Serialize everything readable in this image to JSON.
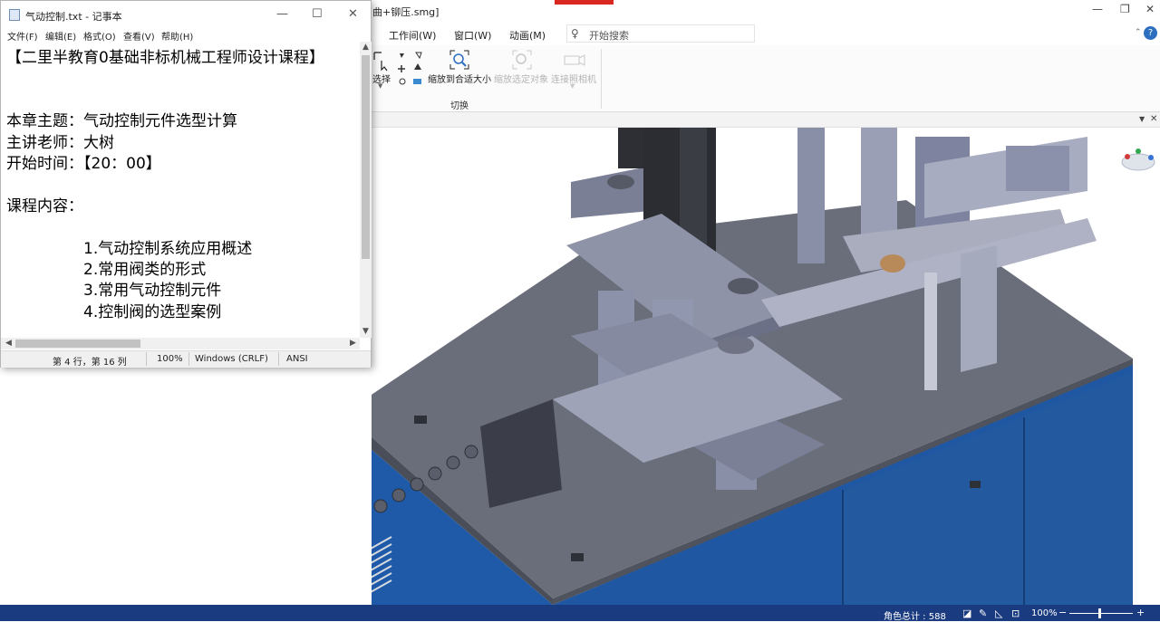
{
  "cad": {
    "title_fragment": "曲+铆压.smg]",
    "menus": [
      "工作间(W)",
      "窗口(W)",
      "动画(M)"
    ],
    "search_placeholder": "开始搜索",
    "help": "?",
    "ribbon": {
      "select_label": "选择",
      "fit_label": "缩放到合适大小",
      "zoom_selected_label": "缩放选定对象",
      "link_camera_label": "连接照相机",
      "group_label": "切换"
    },
    "status": {
      "counter": "角色总计 : 588",
      "zoom": "100%"
    },
    "colors": {
      "status_bg": "#1b3b80",
      "cabinet_blue": "#1e5aa8",
      "plate_gray": "#6a6e7a"
    }
  },
  "notepad": {
    "title": "气动控制.txt - 记事本",
    "menus": [
      "文件(F)",
      "编辑(E)",
      "格式(O)",
      "查看(V)",
      "帮助(H)"
    ],
    "lines": {
      "header": "【二里半教育0基础非标机械工程师设计课程】",
      "topic": "本章主题：气动控制元件选型计算",
      "teacher": "主讲老师：大树",
      "start_time": "开始时间：【20：00】",
      "content_title": "课程内容：",
      "item1": "1.气动控制系统应用概述",
      "item2": "2.常用阀类的形式",
      "item3": "3.常用气动控制元件",
      "item4": "4.控制阀的选型案例"
    },
    "status": {
      "position": "第 4 行，第 16 列",
      "zoom": "100%",
      "line_ending": "Windows (CRLF)",
      "encoding": "ANSI"
    }
  }
}
